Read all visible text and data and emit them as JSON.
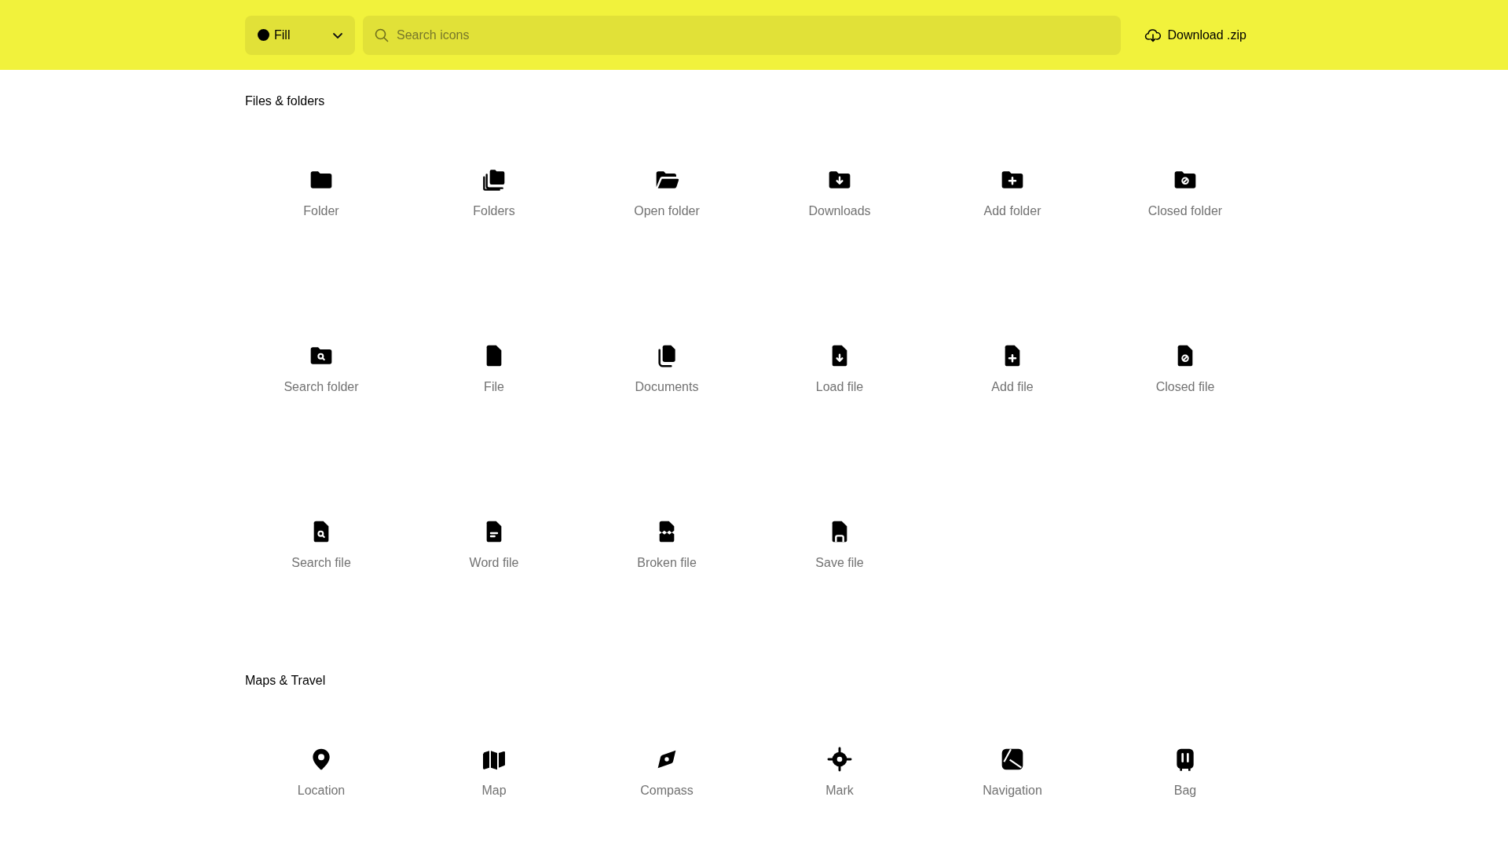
{
  "toolbar": {
    "style_select": {
      "label": "Fill"
    },
    "search": {
      "placeholder": "Search icons"
    },
    "download": {
      "label": "Download .zip"
    }
  },
  "sections": [
    {
      "title": "Files & folders",
      "icons": [
        {
          "kind": "folder",
          "label": "Folder"
        },
        {
          "kind": "folders",
          "label": "Folders"
        },
        {
          "kind": "open-folder",
          "label": "Open folder"
        },
        {
          "kind": "folder-down",
          "label": "Downloads"
        },
        {
          "kind": "folder-plus",
          "label": "Add folder"
        },
        {
          "kind": "folder-ban",
          "label": "Closed folder"
        },
        {
          "kind": "folder-search",
          "label": "Search folder"
        },
        {
          "kind": "file",
          "label": "File"
        },
        {
          "kind": "documents",
          "label": "Documents"
        },
        {
          "kind": "file-down",
          "label": "Load file"
        },
        {
          "kind": "file-plus",
          "label": "Add file"
        },
        {
          "kind": "file-ban",
          "label": "Closed file"
        },
        {
          "kind": "file-search",
          "label": "Search file"
        },
        {
          "kind": "file-text",
          "label": "Word file"
        },
        {
          "kind": "file-broken",
          "label": "Broken file"
        },
        {
          "kind": "file-save",
          "label": "Save file"
        }
      ]
    },
    {
      "title": "Maps & Travel",
      "icons": [
        {
          "kind": "location",
          "label": "Location"
        },
        {
          "kind": "map",
          "label": "Map"
        },
        {
          "kind": "compass",
          "label": "Compass"
        },
        {
          "kind": "mark",
          "label": "Mark"
        },
        {
          "kind": "navigation",
          "label": "Navigation"
        },
        {
          "kind": "bag",
          "label": "Bag"
        }
      ]
    }
  ]
}
